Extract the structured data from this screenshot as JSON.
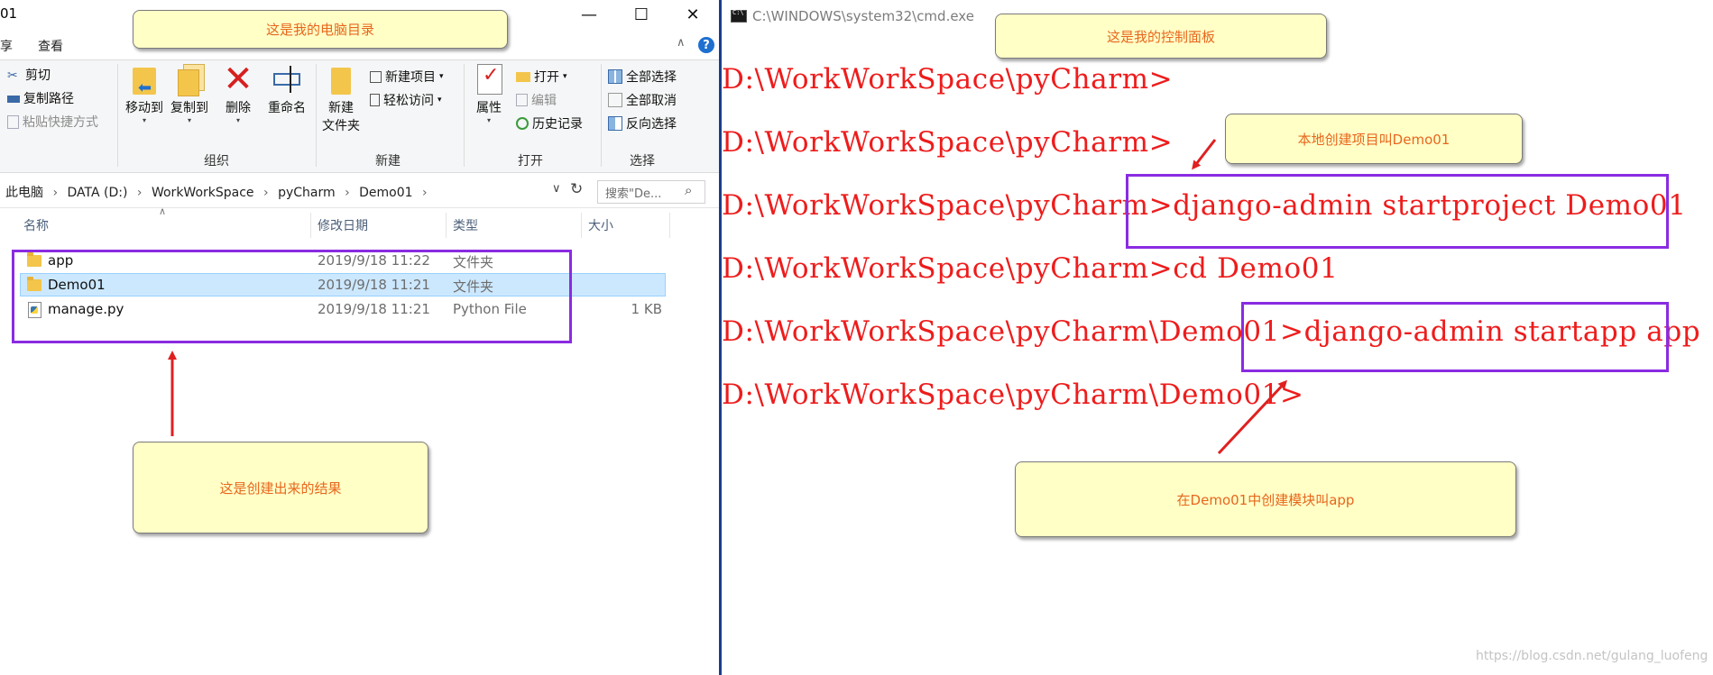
{
  "explorer": {
    "title_fragment": "01",
    "tabs": [
      "享",
      "查看"
    ],
    "help": "?",
    "ribbon": {
      "clipboard": {
        "cut": "剪切",
        "copy_path": "复制路径",
        "paste_shortcut": "粘贴快捷方式"
      },
      "organize": {
        "move_to": "移动到",
        "copy_to": "复制到",
        "delete": "删除",
        "rename": "重命名",
        "label": "组织"
      },
      "new": {
        "new_folder_line1": "新建",
        "new_folder_line2": "文件夹",
        "new_item": "新建项目",
        "easy_access": "轻松访问",
        "label": "新建"
      },
      "open": {
        "properties": "属性",
        "open": "打开",
        "edit": "编辑",
        "history": "历史记录",
        "label": "打开"
      },
      "select": {
        "select_all": "全部选择",
        "select_none": "全部取消",
        "invert": "反向选择",
        "label": "选择"
      }
    },
    "breadcrumb": [
      "此电脑",
      "DATA (D:)",
      "WorkWorkSpace",
      "pyCharm",
      "Demo01"
    ],
    "search_placeholder": "搜索\"De...",
    "columns": {
      "name": "名称",
      "modified": "修改日期",
      "type": "类型",
      "size": "大小"
    },
    "files": [
      {
        "name": "app",
        "modified": "2019/9/18 11:22",
        "type": "文件夹",
        "size": ""
      },
      {
        "name": "Demo01",
        "modified": "2019/9/18 11:21",
        "type": "文件夹",
        "size": ""
      },
      {
        "name": "manage.py",
        "modified": "2019/9/18 11:21",
        "type": "Python File",
        "size": "1 KB"
      }
    ]
  },
  "cmd": {
    "title": "C:\\WINDOWS\\system32\\cmd.exe",
    "lines": [
      "D:\\WorkWorkSpace\\pyCharm>",
      "D:\\WorkWorkSpace\\pyCharm>",
      "D:\\WorkWorkSpace\\pyCharm>django-admin startproject  Demo01",
      "D:\\WorkWorkSpace\\pyCharm>cd Demo01",
      "D:\\WorkWorkSpace\\pyCharm\\Demo01>django-admin startapp app",
      "D:\\WorkWorkSpace\\pyCharm\\Demo01>"
    ]
  },
  "annotations": {
    "explorer_note": "这是我的电脑目录",
    "cmd_note": "这是我的控制面板",
    "project_note": "本地创建项目叫Demo01",
    "result_note": "这是创建出来的结果",
    "app_note": "在Demo01中创建模块叫app"
  },
  "watermark": "https://blog.csdn.net/gulang_luofeng",
  "colors": {
    "terminal_text": "#ee1c1c",
    "highlight_box": "#8a2be2",
    "arrow": "#e02020",
    "note_bg": "#ffffc6",
    "note_text": "#e8661d"
  }
}
